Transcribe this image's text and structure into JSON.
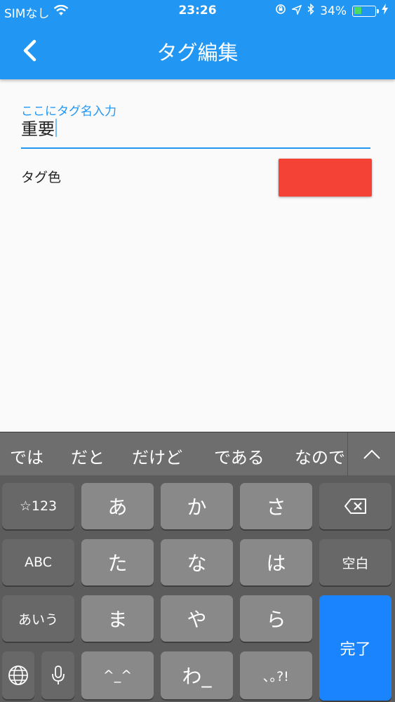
{
  "status": {
    "carrier": "SIMなし",
    "time": "23:26",
    "battery": "34%",
    "battery_level": 0.34
  },
  "appbar": {
    "title": "タグ編集"
  },
  "form": {
    "name_label": "ここにタグ名入力",
    "name_value": "重要",
    "color_label": "タグ色",
    "color": "#f44336"
  },
  "keyboard": {
    "candidates": [
      "では",
      "だと",
      "だけど",
      "である",
      "なので"
    ],
    "keys": {
      "mode_123": "☆123",
      "a": "あ",
      "ka": "か",
      "sa": "さ",
      "abc": "ABC",
      "ta": "た",
      "na": "な",
      "ha": "は",
      "space": "空白",
      "kana": "あいう",
      "ma": "ま",
      "ya": "や",
      "ra": "ら",
      "done": "完了",
      "emoticon": "^_^",
      "wa": "わ_",
      "punct": "､｡?!"
    }
  },
  "colors": {
    "primary": "#2196f3",
    "tag_color": "#f44336",
    "return_key": "#1a84ff"
  }
}
